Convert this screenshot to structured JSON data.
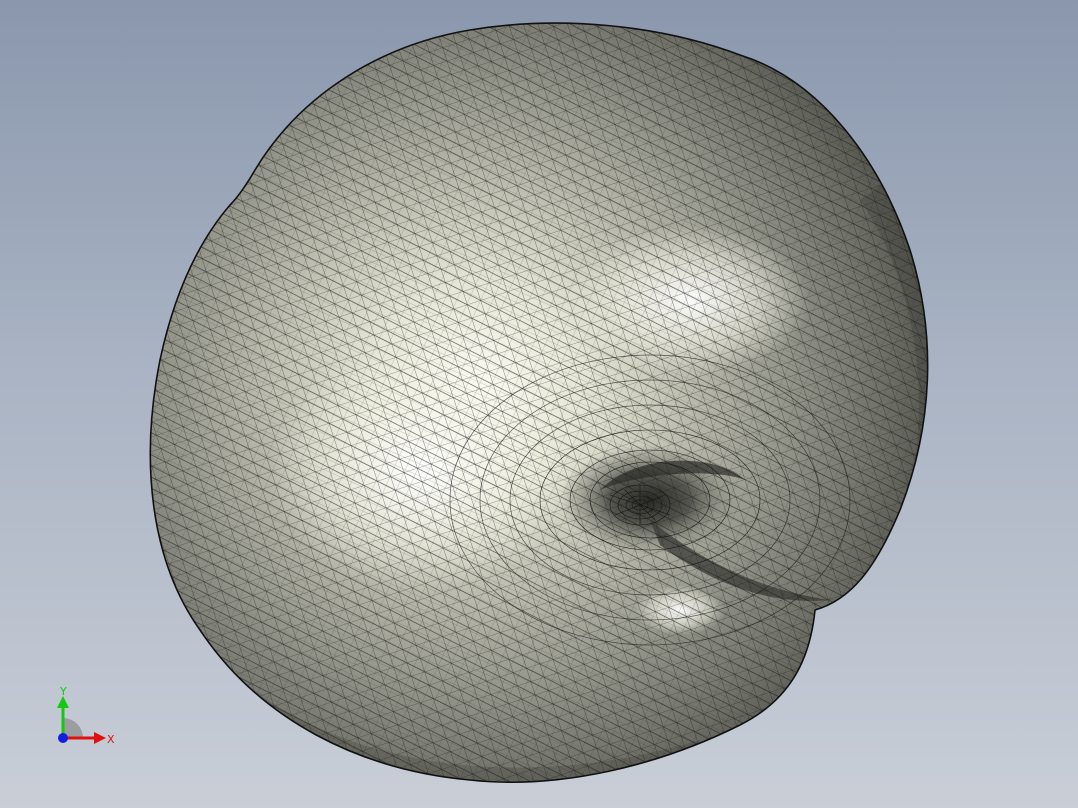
{
  "viewport": {
    "background_top": "#8a97ad",
    "background_bottom": "#c9ced7",
    "model": {
      "name": "apple-mesh-model",
      "shading": "shaded-with-edges",
      "surface_color": "#d9dac8",
      "edge_color": "#1a1a1a"
    }
  },
  "triad": {
    "x_label": "X",
    "y_label": "Y",
    "x_color": "#e01010",
    "y_color": "#14c814",
    "z_color": "#1020e0"
  }
}
